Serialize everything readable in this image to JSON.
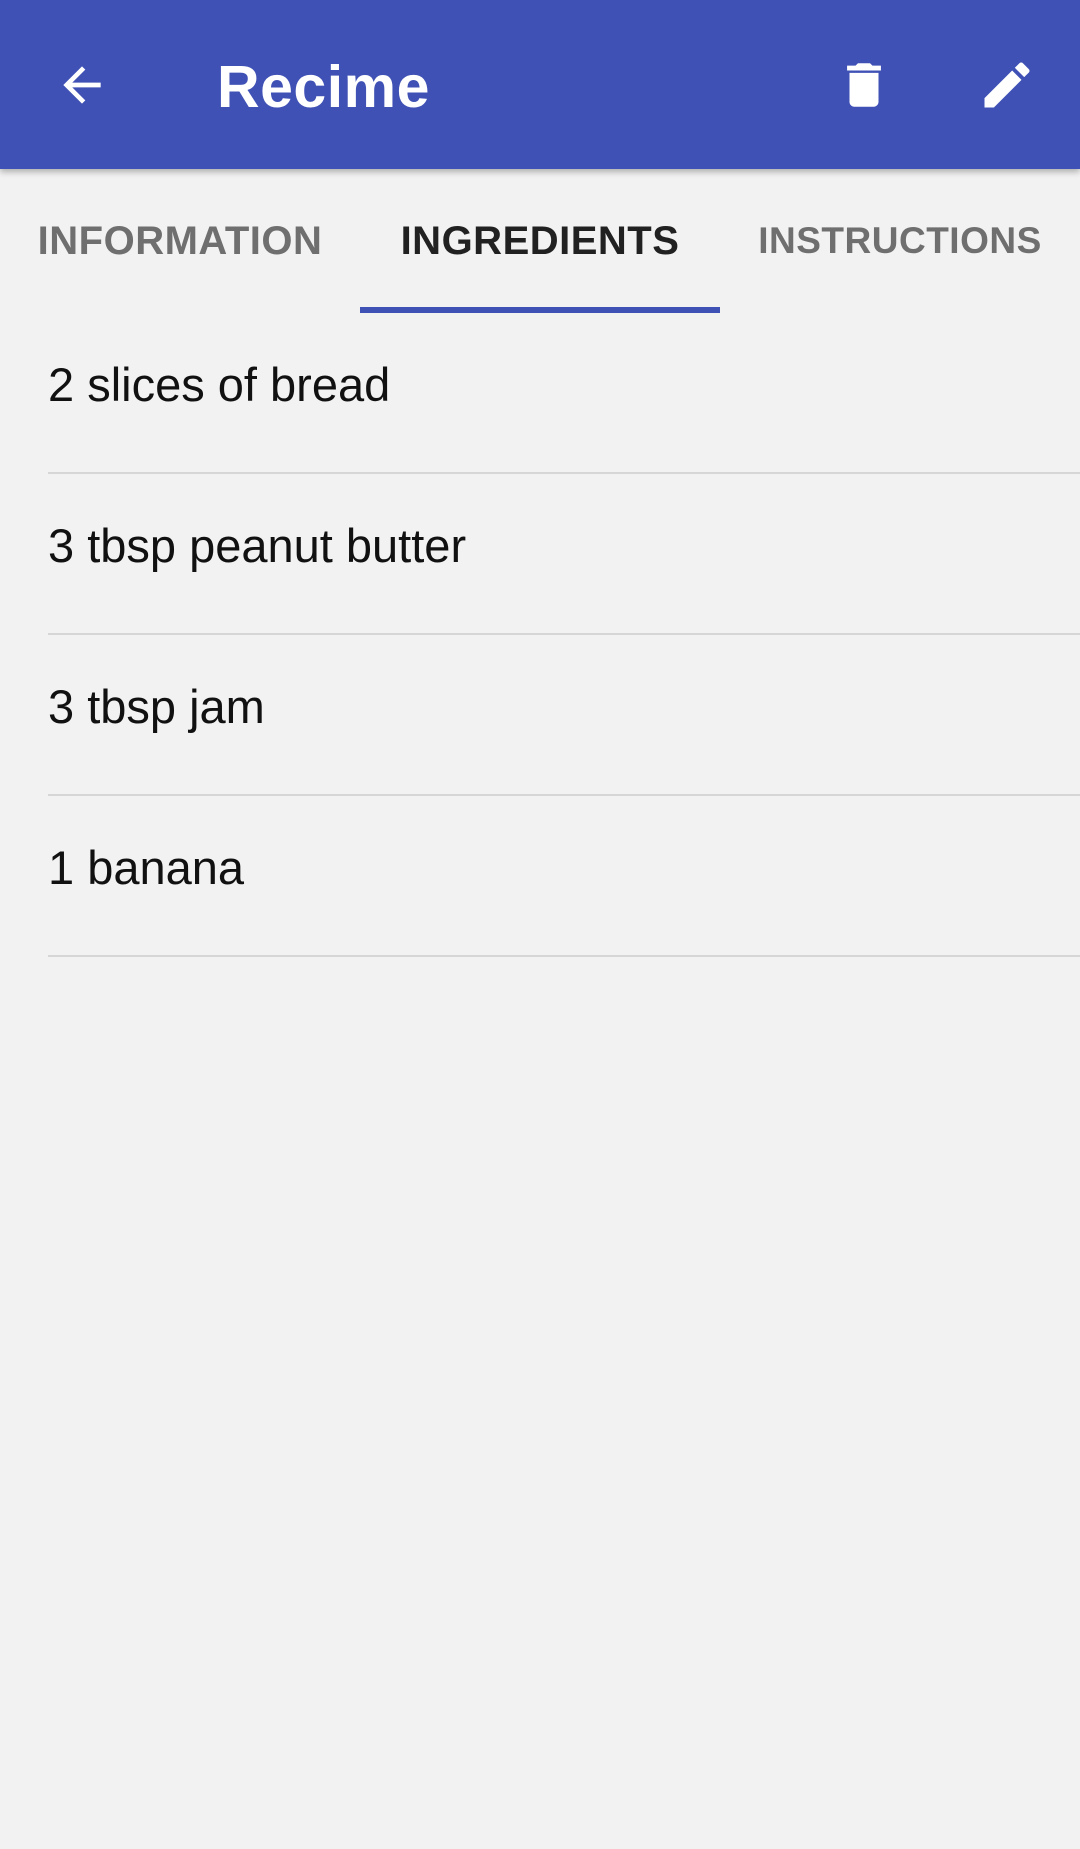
{
  "app_bar": {
    "title": "Recime",
    "background_color": "#3f51b5",
    "icons": [
      "back-arrow-icon",
      "trash-icon",
      "pencil-icon"
    ]
  },
  "tabs": [
    {
      "label": "INFORMATION",
      "selected": false
    },
    {
      "label": "INGREDIENTS",
      "selected": true
    },
    {
      "label": "INSTRUCTIONS",
      "selected": false
    }
  ],
  "ingredients": [
    {
      "text": "2 slices of bread"
    },
    {
      "text": "3 tbsp peanut butter"
    },
    {
      "text": "3 tbsp jam"
    },
    {
      "text": "1 banana"
    }
  ]
}
